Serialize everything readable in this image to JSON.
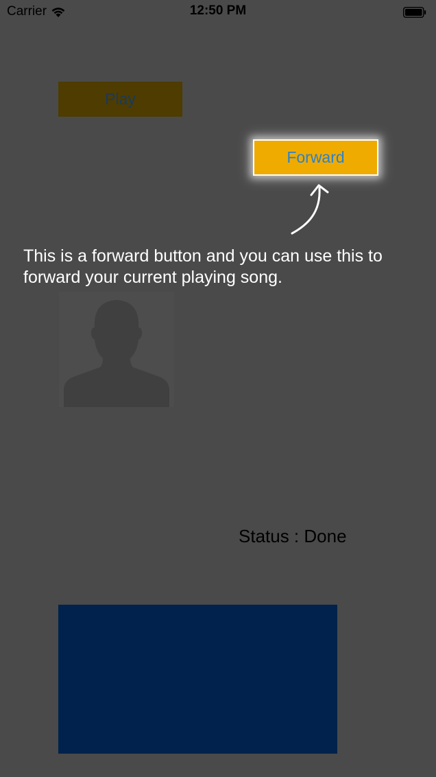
{
  "status_bar": {
    "carrier": "Carrier",
    "time": "12:50 PM",
    "wifi_icon": "wifi-icon",
    "battery_icon": "battery-icon"
  },
  "buttons": {
    "play_label": "Play",
    "forward_label": "Forward"
  },
  "coachmark": {
    "text": "This is a forward button and you can use this to forward your current playing song.",
    "arrow_icon": "curved-arrow-icon"
  },
  "avatar": {
    "icon": "person-silhouette-icon"
  },
  "status": {
    "text": "Status : Done"
  },
  "colors": {
    "overlay_background": "#4a4a4a",
    "play_button": "#4e3c00",
    "forward_button": "#f0ab00",
    "forward_text": "#2c82c9",
    "blue_panel": "#00224c"
  }
}
